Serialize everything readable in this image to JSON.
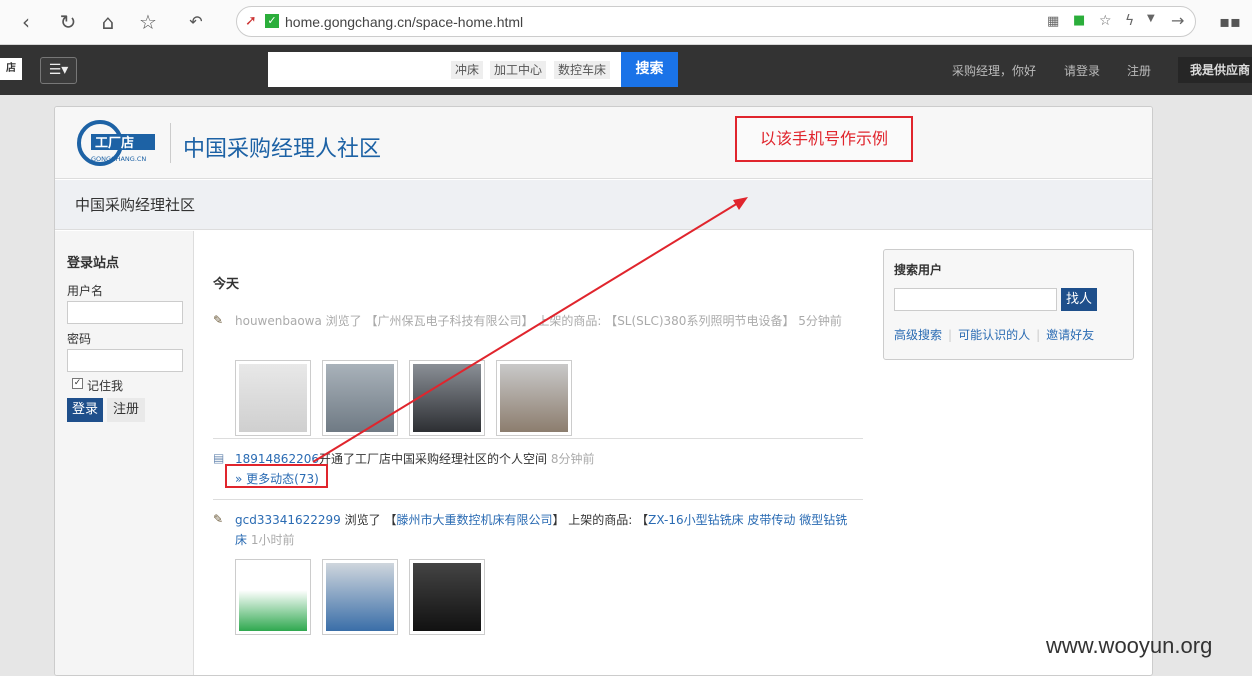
{
  "browser": {
    "url": "home.gongchang.cn/space-home.html"
  },
  "navbar": {
    "search_chips": [
      "冲床",
      "加工中心",
      "数控车床"
    ],
    "search_button": "搜索",
    "greeting": "采购经理，你好",
    "login": "请登录",
    "register": "注册",
    "supplier": "我是供应商"
  },
  "header": {
    "logo_text": "工厂店",
    "logo_sub": "GONGCHANG.CN",
    "title": "中国采购经理人社区",
    "note": "以该手机号作示例"
  },
  "subbar": {
    "title": "中国采购经理社区"
  },
  "login_panel": {
    "title": "登录站点",
    "username_label": "用户名",
    "password_label": "密码",
    "remember": "记住我",
    "login_button": "登录",
    "register_button": "注册"
  },
  "feed": {
    "today": "今天",
    "items": [
      {
        "user": "houwenbaowa",
        "action": " 浏览了 【",
        "company": "广州保瓦电子科技有限公司",
        "mid": "】 上架的商品: 【",
        "product": "SL(SLC)380系列照明节电设备",
        "end": "】",
        "time": "5分钟前"
      },
      {
        "user": "18914862206",
        "action": "开通了工厂店中国采购经理社区的个人空间",
        "time": "8分钟前",
        "more": "» 更多动态(73)"
      },
      {
        "user": "gcd33341622299",
        "action": " 浏览了 【",
        "company": "滕州市大重数控机床有限公司",
        "mid": "】 上架的商品: 【",
        "product": "ZX-16小型钻铣床 皮带传动 微型钻铣床",
        "end": "",
        "time": "1小时前"
      }
    ]
  },
  "search_users": {
    "title": "搜索用户",
    "button": "找人",
    "links": [
      "高级搜索",
      "可能认识的人",
      "邀请好友"
    ]
  },
  "watermark": "www.wooyun.org",
  "colors": {
    "accent": "#1e4f8b",
    "highlight": "#e0252d",
    "link": "#2a6bb3"
  }
}
